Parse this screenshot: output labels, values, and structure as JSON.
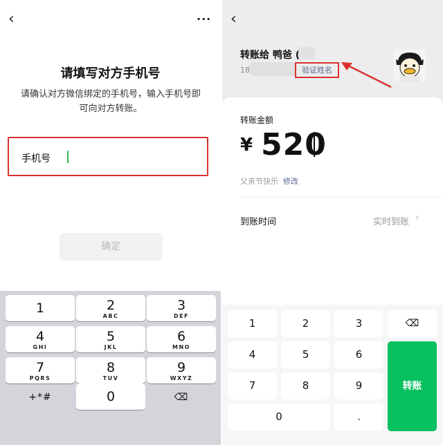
{
  "left": {
    "title": "请填写对方手机号",
    "subtitle": "请确认对方微信绑定的手机号，输入手机号即可向对方转账。",
    "phone_field": {
      "label": "手机号",
      "value": ""
    },
    "confirm_label": "确定",
    "back_icon": "chevron-left-icon",
    "more_icon": "more-horizontal-icon",
    "more_glyph": "···",
    "back_glyph": "‹",
    "keypad": [
      {
        "num": "1",
        "letters": ""
      },
      {
        "num": "2",
        "letters": "ABC"
      },
      {
        "num": "3",
        "letters": "DEF"
      },
      {
        "num": "4",
        "letters": "GHI"
      },
      {
        "num": "5",
        "letters": "JKL"
      },
      {
        "num": "6",
        "letters": "MNO"
      },
      {
        "num": "7",
        "letters": "PQRS"
      },
      {
        "num": "8",
        "letters": "TUV"
      },
      {
        "num": "9",
        "letters": "WXYZ"
      },
      {
        "num": "+*#",
        "letters": ""
      },
      {
        "num": "0",
        "letters": ""
      },
      {
        "num": "⌫",
        "letters": ""
      }
    ]
  },
  "right": {
    "back_glyph": "‹",
    "transfer_to": "转账给 鸭爸 (*",
    "phone_prefix": "18",
    "verify_name": "验证姓名",
    "amount_label": "转账金额",
    "currency": "¥",
    "amount": "520",
    "note": "父亲节快乐",
    "note_edit": "修改",
    "arrival_label": "到账时间",
    "arrival_value": "实时到账",
    "chevron": "›",
    "keypad": {
      "k1": "1",
      "k2": "2",
      "k3": "3",
      "del": "⌫",
      "k4": "4",
      "k5": "5",
      "k6": "6",
      "k7": "7",
      "k8": "8",
      "k9": "9",
      "k0": "0",
      "dot": "."
    },
    "transfer_button": "转账"
  },
  "colors": {
    "highlight_red": "#d9312e",
    "wechat_green": "#07c160",
    "link_blue": "#576b95"
  }
}
